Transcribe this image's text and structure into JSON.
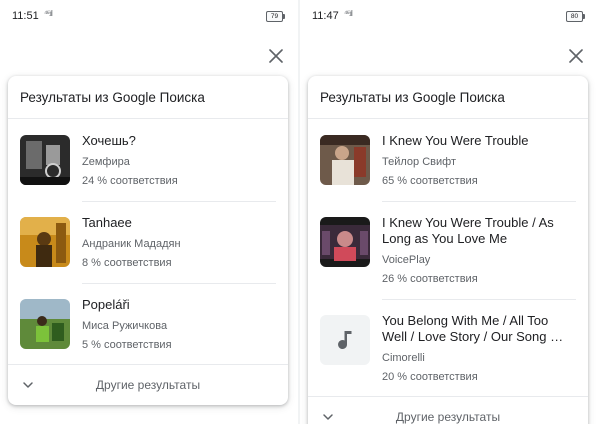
{
  "colors": {
    "accent": "#1a73e8",
    "text_primary": "#202124",
    "text_secondary": "#5f6368",
    "divider": "#e8eaed"
  },
  "left": {
    "status": {
      "time": "11:51",
      "signal": "⁴⁶⫶ıl",
      "battery": "79"
    },
    "card_title": "Результаты из Google Поиска",
    "results": [
      {
        "title": "Хочешь?",
        "artist": "Zемфира",
        "match": "24 % соответствия",
        "icon": "album-art-icon"
      },
      {
        "title": "Tanhaee",
        "artist": "Андраник Мададян",
        "match": "8 % соответствия",
        "icon": "album-art-icon"
      },
      {
        "title": "Popeláři",
        "artist": "Миса Ружичкова",
        "match": "5 % соответствия",
        "icon": "album-art-icon"
      }
    ],
    "more_label": "Другие результаты"
  },
  "right": {
    "status": {
      "time": "11:47",
      "signal": "⁴⁶⫶ıl",
      "battery": "80"
    },
    "card_title": "Результаты из Google Поиска",
    "results": [
      {
        "title": "I Knew You Were Trouble",
        "artist": "Тейлор Свифт",
        "match": "65 % соответствия",
        "icon": "album-art-icon"
      },
      {
        "title": "I Knew You Were Trouble / As Long as You Love Me",
        "artist": "VoicePlay",
        "match": "26 % соответствия",
        "icon": "album-art-icon"
      },
      {
        "title": "You Belong With Me / All Too Well / Love Story / Our Song …",
        "artist": "Cimorelli",
        "match": "20 % соответствия",
        "icon": "music-note-icon"
      }
    ],
    "more_label": "Другие результаты"
  }
}
